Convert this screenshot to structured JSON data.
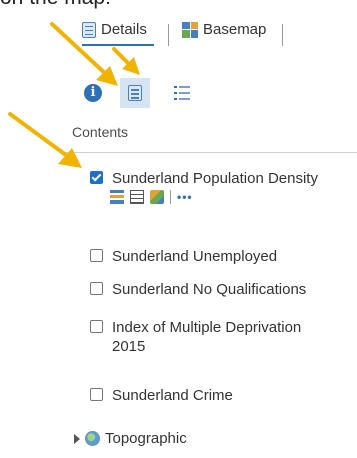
{
  "caption": "on the map:",
  "tabs": {
    "details": "Details",
    "basemap": "Basemap"
  },
  "contents_heading": "Contents",
  "layers": [
    {
      "name": "Sunderland Population Density",
      "checked": true
    },
    {
      "name": "Sunderland Unemployed",
      "checked": false
    },
    {
      "name": "Sunderland No Qualifications",
      "checked": false
    },
    {
      "name": "Index of Multiple Deprivation 2015",
      "checked": false
    },
    {
      "name": "Sunderland Crime",
      "checked": false
    }
  ],
  "basemap_layer": "Topographic",
  "icons": {
    "details_tab": "document-icon",
    "basemap_tab": "basemap-grid-icon",
    "about": "info-icon",
    "legend": "legend-icon",
    "content_list": "content-list-icon",
    "layer_tools": [
      "show-legend-icon",
      "table-icon",
      "change-style-icon",
      "more-options-icon"
    ]
  },
  "colors": {
    "accent": "#2f6fb5",
    "checkbox": "#1b6fcf",
    "arrow": "#f0b400"
  }
}
